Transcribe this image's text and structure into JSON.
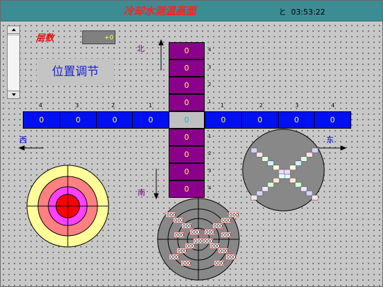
{
  "title": "冷却水测温画面",
  "clock": {
    "prefix": "と",
    "time": "03:53:22"
  },
  "floors": {
    "label": "层数",
    "value": "+0"
  },
  "position_button": "位置调节",
  "directions": {
    "north": "北",
    "south": "南",
    "west": "西",
    "east": "东"
  },
  "vertical_cells": {
    "north": [
      "0",
      "0",
      "0",
      "0"
    ],
    "south": [
      "0",
      "0",
      "0",
      "0"
    ],
    "north_indices": [
      "4",
      "3",
      "2",
      "1"
    ],
    "south_indices": [
      "1",
      "2",
      "3",
      "4"
    ]
  },
  "center_cell": "0",
  "horizontal_cells": {
    "west": [
      "0",
      "0",
      "0",
      "0"
    ],
    "east": [
      "0",
      "0",
      "0",
      "0"
    ],
    "west_indices": [
      "4",
      "3",
      "2",
      "1"
    ],
    "east_indices": [
      "1",
      "2",
      "3",
      "4"
    ]
  },
  "bottom_disc_label": "000",
  "colors": {
    "titlebar": "#3c8c94",
    "vertical_cell": "#8a008a",
    "horizontal_cell": "#0010f0",
    "cell_value": "#ffff60",
    "target_rings": [
      "#ffff99",
      "#ff8080",
      "#ff40ff",
      "#ff0000"
    ]
  }
}
